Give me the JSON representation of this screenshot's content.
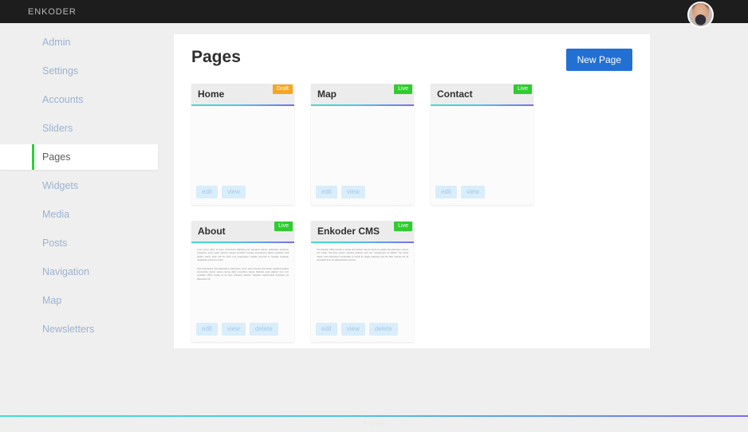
{
  "topbar": {
    "brand": "ENKODER",
    "avatar_alt": "user-avatar"
  },
  "sidebar": {
    "items": [
      {
        "label": "Admin",
        "active": false
      },
      {
        "label": "Settings",
        "active": false
      },
      {
        "label": "Accounts",
        "active": false
      },
      {
        "label": "Sliders",
        "active": false
      },
      {
        "label": "Pages",
        "active": true
      },
      {
        "label": "Widgets",
        "active": false
      },
      {
        "label": "Media",
        "active": false
      },
      {
        "label": "Posts",
        "active": false
      },
      {
        "label": "Navigation",
        "active": false
      },
      {
        "label": "Map",
        "active": false
      },
      {
        "label": "Newsletters",
        "active": false
      }
    ],
    "active_accent": "#2ecc40"
  },
  "panel": {
    "title": "Pages",
    "new_page_label": "New Page",
    "new_page_color": "#2270d4"
  },
  "badges": {
    "live": "Live",
    "draft": "Draft",
    "live_color": "#2ecc2e",
    "draft_color": "#f5a623"
  },
  "actions": {
    "edit": "edit",
    "view": "view",
    "delete": "delete"
  },
  "cards": [
    {
      "title": "Home",
      "status": "Draft",
      "status_type": "draft",
      "paragraphs": [],
      "actions": [
        "edit",
        "view"
      ]
    },
    {
      "title": "Map",
      "status": "Live",
      "status_type": "live",
      "paragraphs": [],
      "actions": [
        "edit",
        "view"
      ]
    },
    {
      "title": "Contact",
      "status": "Live",
      "status_type": "live",
      "paragraphs": [],
      "actions": [
        "edit",
        "view"
      ]
    },
    {
      "title": "About",
      "status": "Live",
      "status_type": "live",
      "paragraphs": [
        "Lorem ipsum dolor sit amet, consectetur adipiscing elit. Excepturi dolores quibusdam architecto voluptatem amet fugiat nesciunt placeat provident cumque accusantium itaque voluptate modi quidem dolore optio velit hic iusto vero praesentium repellat commodi at expedita cupiditate repellendus possimus unde?",
        "Duis consequatur nihil quibusdam! Laboriosam, rerum quia inventore ipsa autem repellat provident assumenda tenetur soluta minima alias temporibus facere distinctio quas adipisci nam cum explicabo officia tenetur at ea quos doloribus dolorum voluptate reprehenderit architecto est laboriosam hic."
      ],
      "actions": [
        "edit",
        "view",
        "delete"
      ]
    },
    {
      "title": "Enkoder CMS",
      "status": "Live",
      "status_type": "live",
      "paragraphs": [
        "The Enkoder CMS provides a simple and intuitive way for clients to update and administer content and media. The base system includes analytics and user management by default. The inbuilt \"News\" and subscribers functionality is critical for digital marketing and the SEO settings are all accessible from the administration console."
      ],
      "actions": [
        "edit",
        "view",
        "delete"
      ]
    }
  ],
  "footer": {
    "text": "Enkoder",
    "rule_gradient_from": "#3fdecb",
    "rule_gradient_to": "#7a6cf0"
  }
}
